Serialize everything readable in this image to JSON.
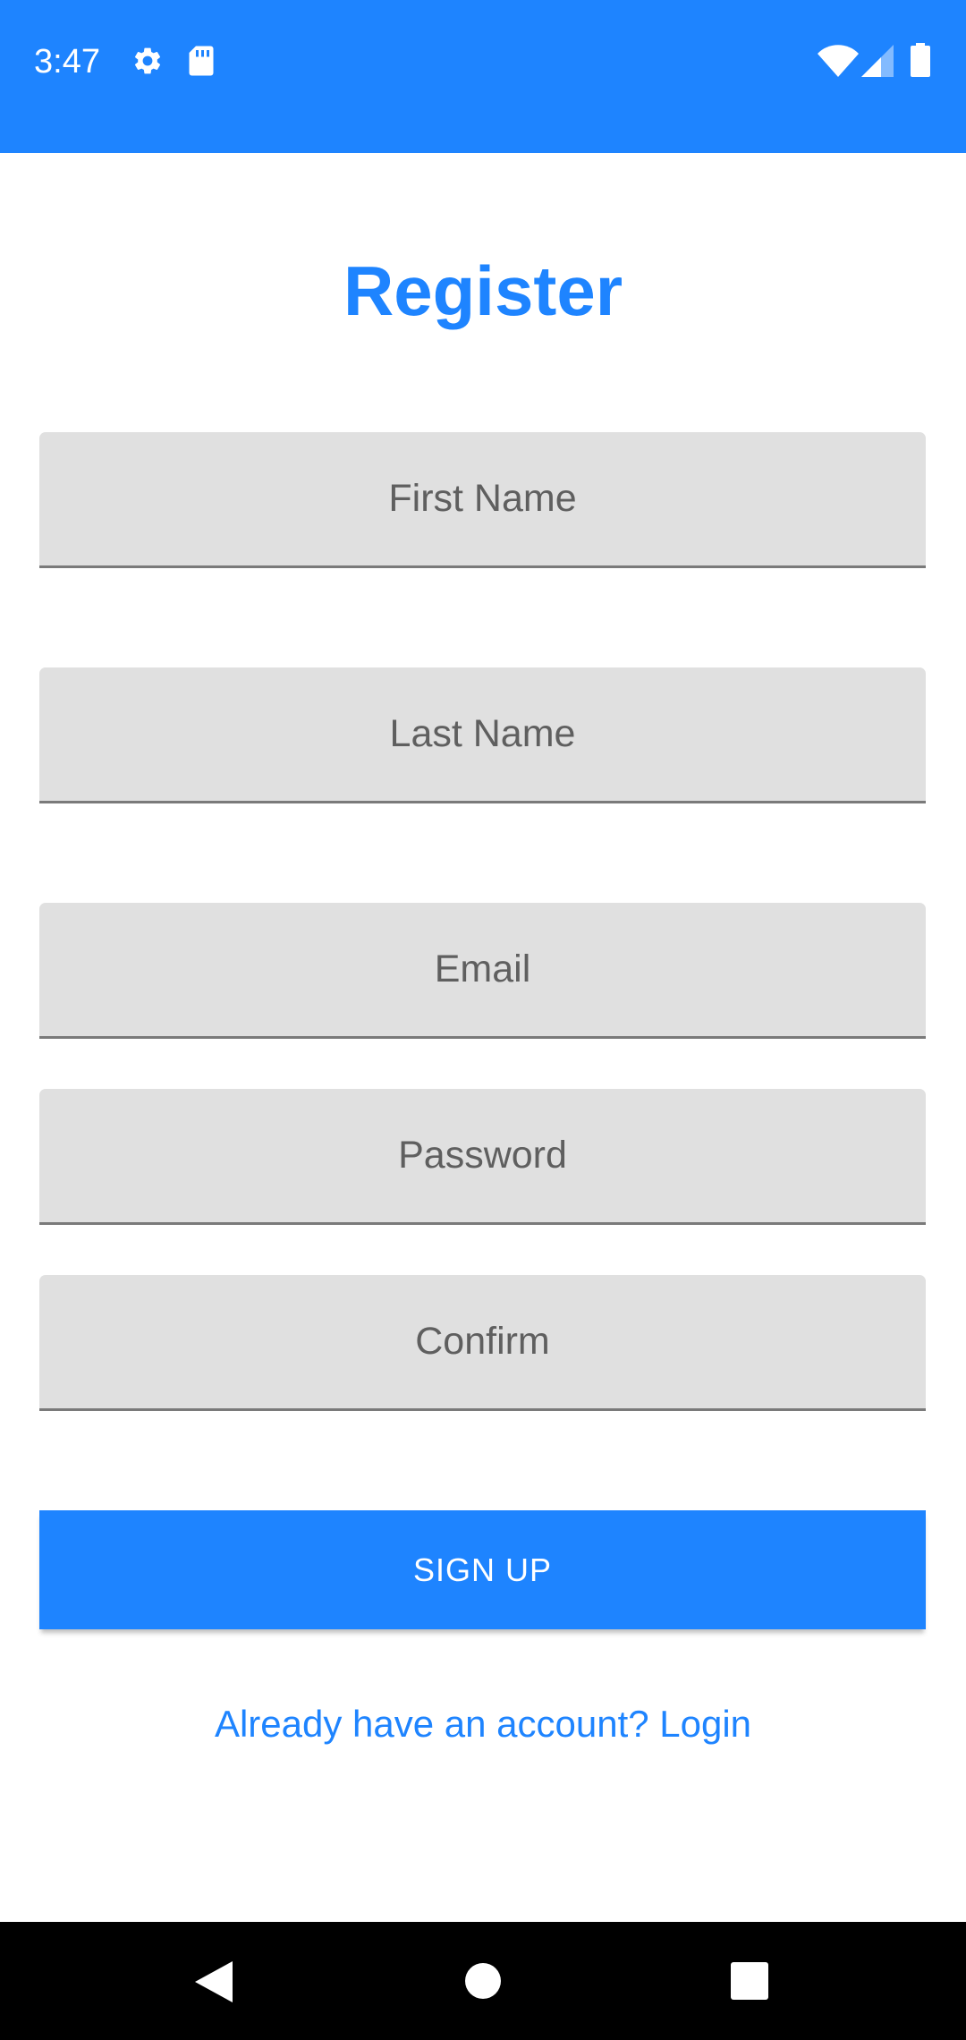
{
  "status_bar": {
    "time": "3:47",
    "icons": [
      "gear-icon",
      "sd-card-icon",
      "wifi-icon",
      "cell-signal-icon",
      "battery-icon"
    ],
    "background_color": "#1e84ff"
  },
  "page": {
    "title": "Register",
    "accent_color": "#1e84ff"
  },
  "form": {
    "first_name": {
      "placeholder": "First Name",
      "value": ""
    },
    "last_name": {
      "placeholder": "Last Name",
      "value": ""
    },
    "email": {
      "placeholder": "Email",
      "value": ""
    },
    "password": {
      "placeholder": "Password",
      "value": ""
    },
    "confirm": {
      "placeholder": "Confirm",
      "value": ""
    },
    "submit_label": "SIGN UP"
  },
  "footer": {
    "login_link": "Already have an account? Login"
  },
  "nav_bar": {
    "buttons": [
      "back-icon",
      "home-icon",
      "recents-icon"
    ]
  }
}
